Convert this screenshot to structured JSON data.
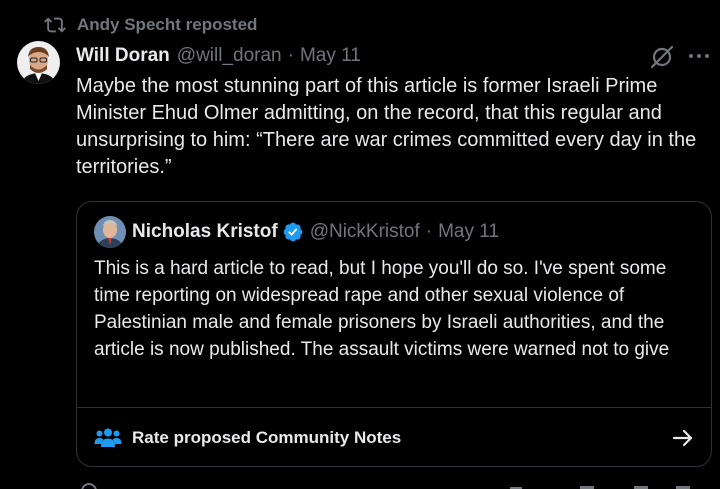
{
  "repost": {
    "icon": "repost-icon",
    "label": "Andy Specht reposted"
  },
  "tweet": {
    "avatar": "avatar",
    "author_name": "Will Doran",
    "author_handle": "@will_doran",
    "separator": "·",
    "date": "May 11",
    "grok_icon": "grok-icon",
    "more_icon": "more-icon",
    "text": "Maybe the most stunning part of this article is former Israeli Prime Minister Ehud Olmer admitting, on the record, that this regular and unsurprising to him: “There are war crimes committed every day in the territories.”"
  },
  "quote": {
    "author_name": "Nicholas Kristof",
    "verified_icon": "verified-badge-icon",
    "author_handle": "@NickKristof",
    "separator": "·",
    "date": "May 11",
    "text": "This is a hard article to read, but I hope you'll do so. I've spent some time reporting on widespread rape and other sexual violence of Palestinian male and female prisoners by Israeli authorities, and the article is now published. The assault victims were warned not to give",
    "community_notes": {
      "icon": "community-notes-icon",
      "label": "Rate proposed Community Notes",
      "arrow_icon": "arrow-right-icon"
    }
  },
  "colors": {
    "background": "#000000",
    "text_primary": "#e7e9ea",
    "text_secondary": "#71767b",
    "border": "#2f3336",
    "accent_blue": "#1d9bf0"
  }
}
